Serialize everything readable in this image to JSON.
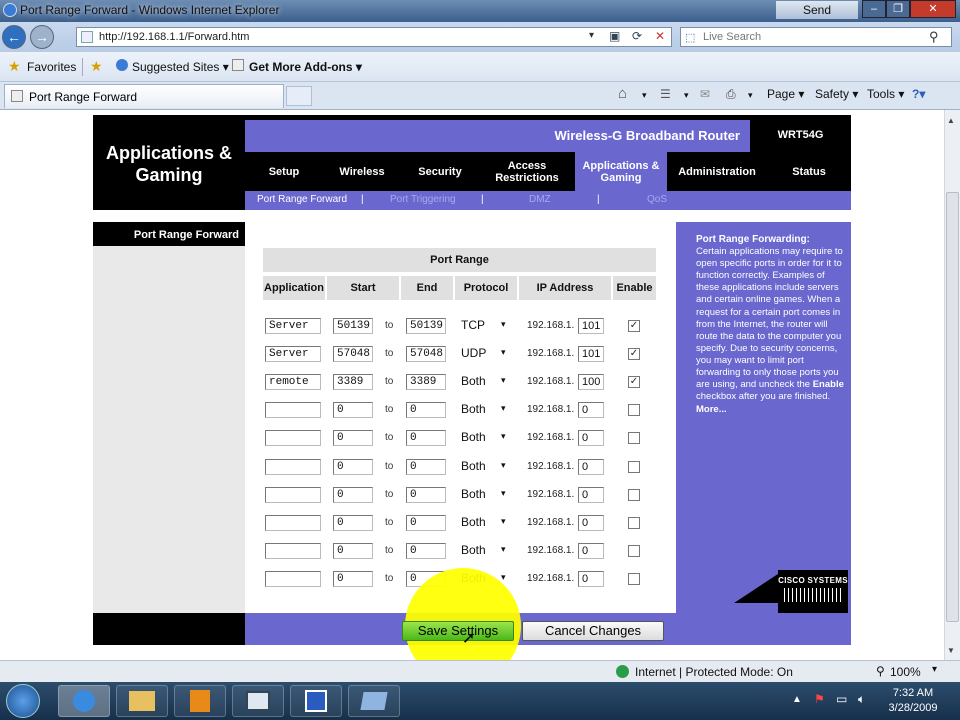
{
  "window": {
    "title": "Port Range Forward - Windows Internet Explorer",
    "send_feedback": "Send Feedback"
  },
  "address": {
    "url": "http://192.168.1.1/Forward.htm",
    "search_placeholder": "Live Search"
  },
  "favorites": {
    "favorites_label": "Favorites",
    "suggested": "Suggested Sites ▾",
    "addons": "Get More Add-ons ▾"
  },
  "tab": {
    "label": "Port Range Forward"
  },
  "commands": {
    "page": "Page ▾",
    "safety": "Safety ▾",
    "tools": "Tools ▾"
  },
  "router": {
    "brand": "Applications & Gaming",
    "product": "Wireless-G Broadband Router",
    "model": "WRT54G",
    "nav": [
      "Setup",
      "Wireless",
      "Security",
      "Access Restrictions",
      "Applications & Gaming",
      "Administration",
      "Status"
    ],
    "subnav": [
      "Port Range Forward",
      "Port Triggering",
      "DMZ",
      "QoS"
    ],
    "subnav_sep": "|",
    "left_header": "Port Range Forward",
    "table_title": "Port Range",
    "columns": [
      "Application",
      "Start",
      "End",
      "Protocol",
      "IP Address",
      "Enable"
    ],
    "to_label": "to",
    "ip_prefix": "192.168.1.",
    "rows": [
      {
        "app": "Server",
        "start": "50139",
        "end": "50139",
        "protocol": "TCP",
        "ip": "101",
        "enabled": true
      },
      {
        "app": "Server",
        "start": "57048",
        "end": "57048",
        "protocol": "UDP",
        "ip": "101",
        "enabled": true
      },
      {
        "app": "remote",
        "start": "3389",
        "end": "3389",
        "protocol": "Both",
        "ip": "100",
        "enabled": true
      },
      {
        "app": "",
        "start": "0",
        "end": "0",
        "protocol": "Both",
        "ip": "0",
        "enabled": false
      },
      {
        "app": "",
        "start": "0",
        "end": "0",
        "protocol": "Both",
        "ip": "0",
        "enabled": false
      },
      {
        "app": "",
        "start": "0",
        "end": "0",
        "protocol": "Both",
        "ip": "0",
        "enabled": false
      },
      {
        "app": "",
        "start": "0",
        "end": "0",
        "protocol": "Both",
        "ip": "0",
        "enabled": false
      },
      {
        "app": "",
        "start": "0",
        "end": "0",
        "protocol": "Both",
        "ip": "0",
        "enabled": false
      },
      {
        "app": "",
        "start": "0",
        "end": "0",
        "protocol": "Both",
        "ip": "0",
        "enabled": false
      },
      {
        "app": "",
        "start": "0",
        "end": "0",
        "protocol": "Both",
        "ip": "0",
        "enabled": false
      }
    ],
    "help": {
      "title": "Port Range Forwarding:",
      "body_1": "Certain applications may require to open specific ports in order for it to function correctly. Examples of these applications include servers and certain online games. When a request for a certain port comes in from the Internet, the router will route the data to the computer you specify. Due to security concerns, you may want to limit port forwarding to only those ports you are using, and uncheck the ",
      "body_bold": "Enable",
      "body_2": " checkbox after you are finished.",
      "more": "More..."
    },
    "cisco": "Cisco Systems",
    "save": "Save Settings",
    "cancel": "Cancel Changes"
  },
  "status": {
    "zone": "Internet | Protected Mode: On",
    "zoom": "100%"
  },
  "clock": {
    "time": "7:32 AM",
    "date": "3/28/2009"
  },
  "colors": {
    "router_purple": "#6a67cf",
    "highlight": "#ffff00"
  }
}
